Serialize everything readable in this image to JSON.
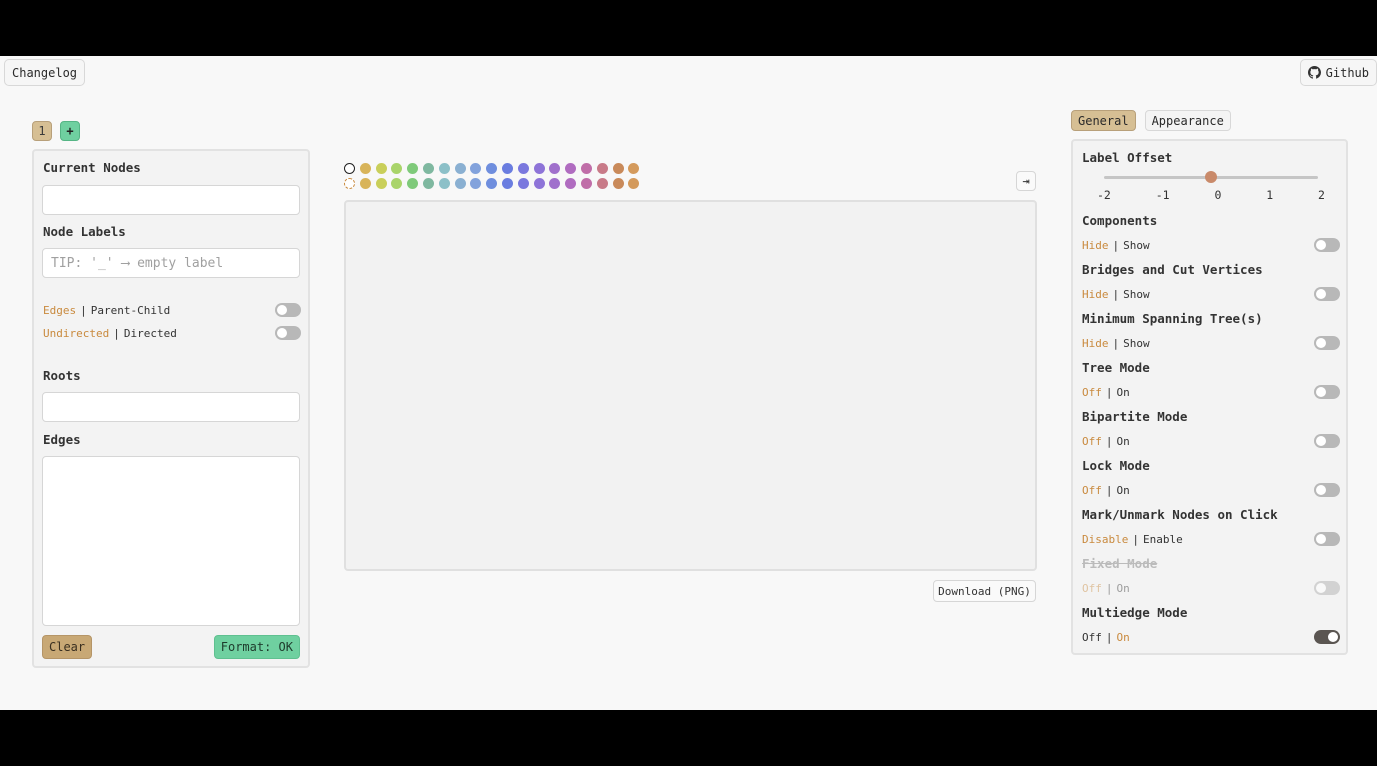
{
  "top": {
    "changelog_label": "Changelog",
    "github_label": "Github"
  },
  "graph_tabs": {
    "tab1_label": "1",
    "add_label": "+"
  },
  "left_panel": {
    "current_nodes_label": "Current Nodes",
    "current_nodes_value": "",
    "node_labels_label": "Node Labels",
    "node_labels_placeholder": "TIP: '_' ⟶ empty label",
    "edges_toggle": {
      "option_a": "Edges",
      "option_b": "Parent-Child",
      "on": false
    },
    "directed_toggle": {
      "option_a": "Undirected",
      "option_b": "Directed",
      "on": false
    },
    "roots_label": "Roots",
    "roots_value": "",
    "edges_label": "Edges",
    "edges_value": "",
    "clear_label": "Clear",
    "format_label": "Format: OK"
  },
  "palette": {
    "row1": [
      "#ffffff",
      "#d8b45a",
      "#c9cf5a",
      "#a9d46a",
      "#7fca7a",
      "#7fb8a0",
      "#8cc0c8",
      "#8ab0d2",
      "#82a2dc",
      "#6f8ede",
      "#6a7de0",
      "#7a78de",
      "#8e74d8",
      "#a070cc",
      "#b06cc0",
      "#c06ea8",
      "#c87a88",
      "#c98a5a",
      "#d49a5c"
    ],
    "row2": [
      "#ffffff",
      "#d8b45a",
      "#c9cf5a",
      "#a9d46a",
      "#7fca7a",
      "#7fb8a0",
      "#8cc0c8",
      "#8ab0d2",
      "#82a2dc",
      "#6f8ede",
      "#6a7de0",
      "#7a78de",
      "#8e74d8",
      "#a070cc",
      "#b06cc0",
      "#c06ea8",
      "#c87a88",
      "#c98a5a",
      "#d49a5c"
    ]
  },
  "canvas": {
    "expand_icon": "⇥",
    "download_label": "Download (PNG)"
  },
  "right_tabs": {
    "general_label": "General",
    "appearance_label": "Appearance",
    "active": "General"
  },
  "general": {
    "label_offset": {
      "label": "Label Offset",
      "ticks": [
        "-2",
        "-1",
        "0",
        "1",
        "2"
      ],
      "value": 0,
      "min": -2,
      "max": 2
    },
    "settings": [
      {
        "title": "Components",
        "a": "Hide",
        "b": "Show",
        "on": false,
        "disabled": false
      },
      {
        "title": "Bridges and Cut Vertices",
        "a": "Hide",
        "b": "Show",
        "on": false,
        "disabled": false
      },
      {
        "title": "Minimum Spanning Tree(s)",
        "a": "Hide",
        "b": "Show",
        "on": false,
        "disabled": false
      },
      {
        "title": "Tree Mode",
        "a": "Off",
        "b": "On",
        "on": false,
        "disabled": false
      },
      {
        "title": "Bipartite Mode",
        "a": "Off",
        "b": "On",
        "on": false,
        "disabled": false
      },
      {
        "title": "Lock Mode",
        "a": "Off",
        "b": "On",
        "on": false,
        "disabled": false
      },
      {
        "title": "Mark/Unmark Nodes on Click",
        "a": "Disable",
        "b": "Enable",
        "on": false,
        "disabled": false
      },
      {
        "title": "Fixed Mode",
        "a": "Off",
        "b": "On",
        "on": false,
        "disabled": true
      },
      {
        "title": "Multiedge Mode",
        "a": "Off",
        "b": "On",
        "on": true,
        "disabled": false
      }
    ]
  }
}
